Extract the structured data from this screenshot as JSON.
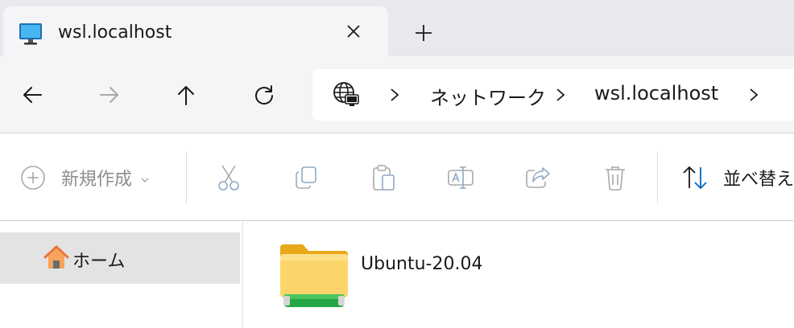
{
  "tab": {
    "title": "wsl.localhost",
    "icon": "computer-icon"
  },
  "nav": {
    "back_icon": "arrow-left-icon",
    "forward_icon": "arrow-right-icon",
    "up_icon": "arrow-up-icon",
    "refresh_icon": "refresh-icon"
  },
  "address": {
    "breadcrumbs": [
      "ネットワーク",
      "wsl.localhost"
    ]
  },
  "toolbar": {
    "new_label": "新規作成",
    "sort_label": "並べ替え"
  },
  "sidebar": {
    "items": [
      {
        "label": "ホーム",
        "icon": "home-icon",
        "selected": true
      }
    ]
  },
  "files": [
    {
      "name": "Ubuntu-20.04",
      "icon": "network-folder-icon"
    }
  ],
  "colors": {
    "accent": "#0067c0",
    "disabled": "#8fa8c4",
    "folder": "#f7c948"
  }
}
